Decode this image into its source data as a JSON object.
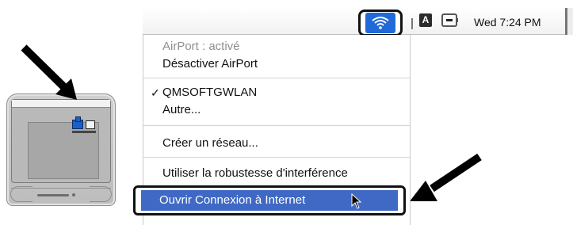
{
  "menubar": {
    "clock": "Wed 7:24 PM",
    "keyboard_icon_glyph": "A",
    "icons": [
      "script-icon",
      "wifi-icon",
      "keyboard-icon",
      "battery-icon"
    ]
  },
  "menu": {
    "status": "AirPort : activé",
    "toggle": "Désactiver AirPort",
    "current_network": "QMSOFTGWLAN",
    "check_glyph": "✓",
    "other": "Autre...",
    "create_network": "Créer un réseau...",
    "interference": "Utiliser la robustesse d'interférence",
    "open_connection": "Ouvrir Connexion à Internet"
  },
  "colors": {
    "highlight": "#3f69c4",
    "wifi_icon_bg": "#1f6ad8"
  }
}
